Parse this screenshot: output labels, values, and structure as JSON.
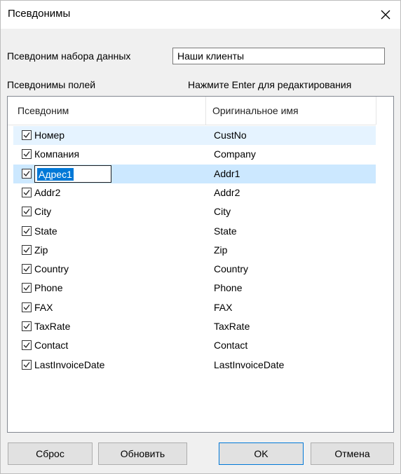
{
  "window": {
    "title": "Псевдонимы",
    "close_icon": "close-icon"
  },
  "dataset": {
    "label": "Псевдоним набора данных",
    "value": "Наши клиенты"
  },
  "fields": {
    "label": "Псевдонимы полей",
    "hint": "Нажмите Enter для редактирования"
  },
  "list": {
    "columns": [
      "Псевдоним",
      "Оригинальное имя"
    ],
    "rows": [
      {
        "alias": "Номер",
        "original": "CustNo",
        "checked": true
      },
      {
        "alias": "Компания",
        "original": "Company",
        "checked": true
      },
      {
        "alias": "Адрес1",
        "original": "Addr1",
        "checked": true
      },
      {
        "alias": "Addr2",
        "original": "Addr2",
        "checked": true
      },
      {
        "alias": "City",
        "original": "City",
        "checked": true
      },
      {
        "alias": "State",
        "original": "State",
        "checked": true
      },
      {
        "alias": "Zip",
        "original": "Zip",
        "checked": true
      },
      {
        "alias": "Country",
        "original": "Country",
        "checked": true
      },
      {
        "alias": "Phone",
        "original": "Phone",
        "checked": true
      },
      {
        "alias": "FAX",
        "original": "FAX",
        "checked": true
      },
      {
        "alias": "TaxRate",
        "original": "TaxRate",
        "checked": true
      },
      {
        "alias": "Contact",
        "original": "Contact",
        "checked": true
      },
      {
        "alias": "LastInvoiceDate",
        "original": "LastInvoiceDate",
        "checked": true
      }
    ]
  },
  "buttons": {
    "reset": "Сброс",
    "update": "Обновить",
    "ok": "OK",
    "cancel": "Отмена"
  },
  "colors": {
    "selection": "#cce8ff",
    "hover": "#e5f3ff",
    "edit_highlight": "#0078d7"
  }
}
